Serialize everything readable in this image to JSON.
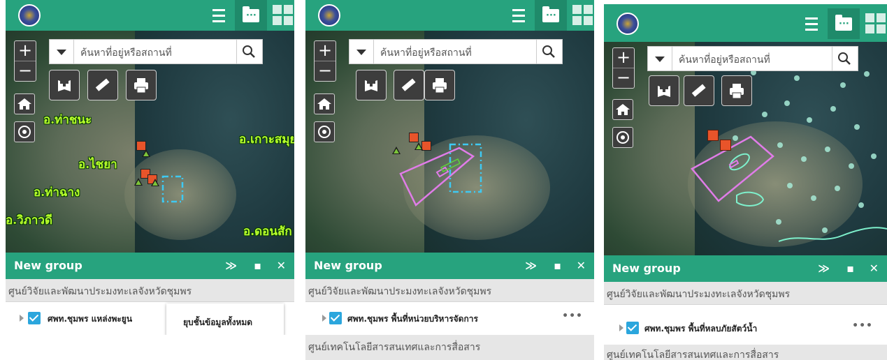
{
  "panels": [
    {
      "toolbar": {
        "icons": [
          "list-icon",
          "folder-icon",
          "grid-icon"
        ]
      },
      "search": {
        "placeholder": "ค้นหาที่อยู่หรือสถานที่"
      },
      "zoom": {
        "in": "+",
        "out": "−"
      },
      "map_labels": [
        "อ.ท่าชนะ",
        "อ.ไชยา",
        "อ.ท่าฉาง",
        "อ.วิภาวดี",
        "อ.เกาะสมุย",
        "อ.ดอนสัก"
      ],
      "group": {
        "title": "New group",
        "category": "ศูนย์วิจัยและพัฒนาประมงทะเลจังหวัดชุมพร",
        "row_label": "ศพท.ชุมพร แหล่งพะยูน",
        "menu_item": "ยุบชั้นข้อมูลทั้งหมด"
      }
    },
    {
      "toolbar": {
        "icons": [
          "list-icon",
          "folder-icon",
          "grid-icon"
        ]
      },
      "search": {
        "placeholder": "ค้นหาที่อยู่หรือสถานที่"
      },
      "zoom": {
        "in": "+",
        "out": "−"
      },
      "group": {
        "title": "New group",
        "category": "ศูนย์วิจัยและพัฒนาประมงทะเลจังหวัดชุมพร",
        "row_label": "ศพท.ชุมพร พื้นที่หน่วยบริหารจัดการ",
        "more": "•••",
        "category2": "ศูนย์เทคโนโลยีสารสนเทศและการสื่อสาร"
      }
    },
    {
      "toolbar": {
        "icons": [
          "list-icon",
          "folder-icon",
          "grid-icon"
        ]
      },
      "search": {
        "placeholder": "ค้นหาที่อยู่หรือสถานที่"
      },
      "zoom": {
        "in": "+",
        "out": "−"
      },
      "group": {
        "title": "New group",
        "category": "ศูนย์วิจัยและพัฒนาประมงทะเลจังหวัดชุมพร",
        "row_label": "ศพท.ชุมพร พื้นที่หลบภัยสัตว์น้ำ",
        "more": "•••",
        "category2": "ศูนย์เทคโนโลยีสารสนเทศและการสื่อสาร"
      }
    }
  ],
  "colors": {
    "header_green": "#27a37e",
    "checkbox_blue": "#2ba6dd",
    "label_green": "#b6ff2a",
    "polygon_violet": "#e07ce8",
    "marker_orange": "#e8542a"
  }
}
